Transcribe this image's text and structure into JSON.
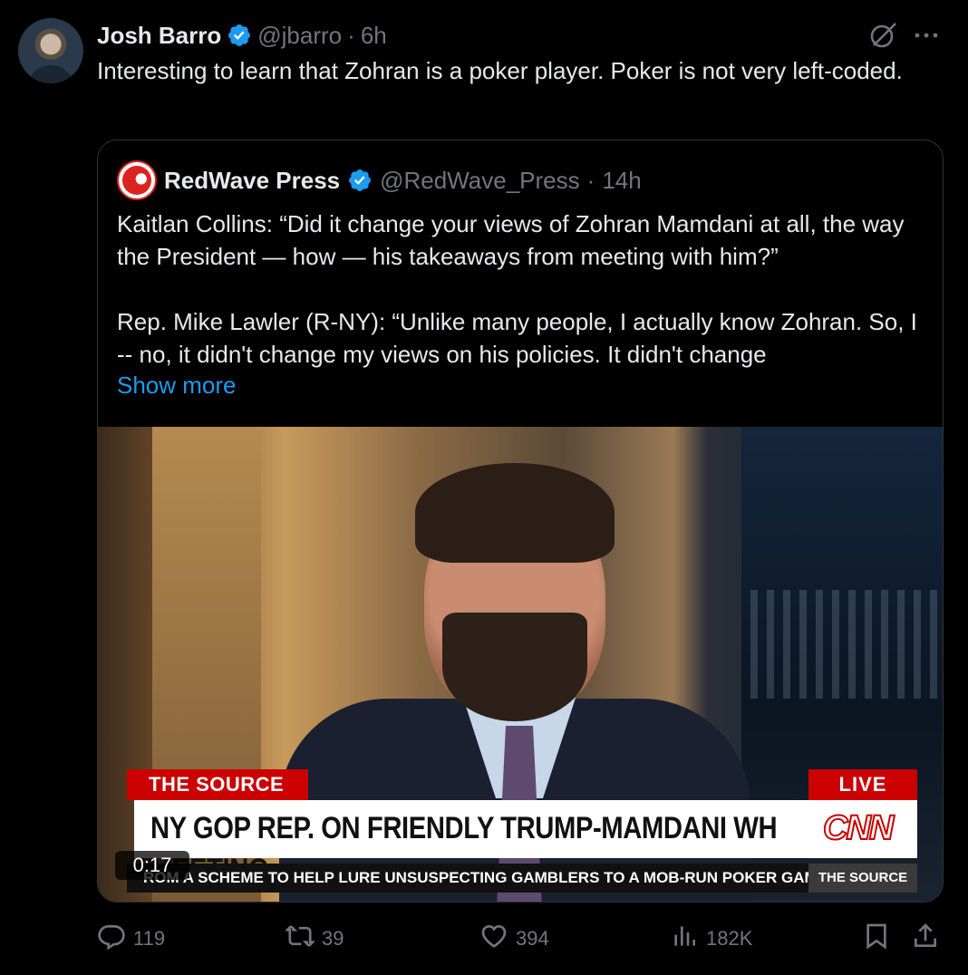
{
  "author": {
    "name": "Josh Barro",
    "handle": "@jbarro",
    "separator": "·",
    "time": "6h"
  },
  "tweet": {
    "text": "Interesting to learn that Zohran is a poker player. Poker is not very left-coded."
  },
  "quoted": {
    "name": "RedWave Press",
    "handle": "@RedWave_Press",
    "separator": "·",
    "time": "14h",
    "paragraph_1": "Kaitlan Collins: “Did it change your views of Zohran Mamdani at all, the way the President — how — his takeaways from meeting with him?”",
    "paragraph_2": "Rep. Mike Lawler (R-NY): “Unlike many people, I actually know Zohran. So, I -- no, it didn't change my views on his policies. It didn't change",
    "show_more": "Show more",
    "video": {
      "source_tag": "THE SOURCE",
      "live_tag": "LIVE",
      "headline": "NY GOP REP. ON FRIENDLY TRUMP-MAMDANI WH MEETING",
      "network_logo": "CNN",
      "ticker": "ROM A SCHEME TO HELP LURE UNSUSPECTING GAMBLERS TO A MOB-RUN POKER GAM",
      "ticker_brand": "THE SOURCE",
      "timestamp": "0:17"
    }
  },
  "actions": {
    "replies": "119",
    "reposts": "39",
    "likes": "394",
    "views": "182K"
  },
  "icons": {
    "verified": "verified-badge-icon",
    "grok": "grok-icon",
    "more": "more-icon",
    "reply": "reply-icon",
    "repost": "repost-icon",
    "like": "heart-icon",
    "views": "views-icon",
    "bookmark": "bookmark-icon",
    "share": "share-icon"
  },
  "colors": {
    "background": "#000000",
    "text": "#e7e9ea",
    "muted": "#71767b",
    "link": "#1d9bf0",
    "verified": "#1d9bf0",
    "cnn_red": "#cc0000"
  }
}
